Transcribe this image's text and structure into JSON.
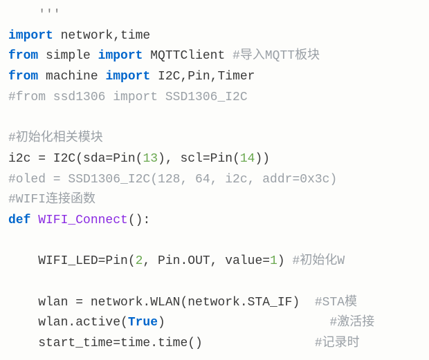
{
  "chart_data": null,
  "code": {
    "line01_docstr": "    '''",
    "line02_kw_import": "import",
    "line02_rest": " network,time",
    "line03_kw_from": "from",
    "line03_mod": " simple ",
    "line03_kw_import": "import",
    "line03_rest": " MQTTClient ",
    "line03_cmt": "#导入MQTT板块",
    "line04_kw_from": "from",
    "line04_mod": " machine ",
    "line04_kw_import": "import",
    "line04_rest": " I2C,Pin,Timer",
    "line05_cmt": "#from ssd1306 import SSD1306_I2C",
    "line07_cmt": "#初始化相关模块",
    "line08_a": "i2c = I2C(sda=Pin(",
    "line08_n1": "13",
    "line08_b": "), scl=Pin(",
    "line08_n2": "14",
    "line08_c": "))",
    "line09_cmt": "#oled = SSD1306_I2C(128, 64, i2c, addr=0x3c)",
    "line10_cmt": "#WIFI连接函数",
    "line11_kw_def": "def",
    "line11_fn": " WIFI_Connect",
    "line11_paren": "():",
    "line13_a": "    WIFI_LED=Pin(",
    "line13_n1": "2",
    "line13_b": ", Pin.OUT, value=",
    "line13_n2": "1",
    "line13_c": ") ",
    "line13_cmt": "#初始化W",
    "line15_a": "    wlan = network.WLAN(network.STA_IF)  ",
    "line15_cmt": "#STA模",
    "line16_a": "    wlan.active(",
    "line16_true": "True",
    "line16_b": ")                      ",
    "line16_cmt": "#激活接",
    "line17_a": "    start_time=time.time()               ",
    "line17_cmt": "#记录时"
  }
}
